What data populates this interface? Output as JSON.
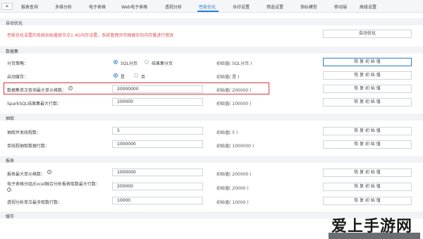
{
  "tabs": [
    "报表查询",
    "多维分析",
    "电子表格",
    "Web电子表格",
    "透视分析",
    "性能优化",
    "水印设置",
    "筛选设置",
    "指标模型",
    "移动端",
    "高级设置"
  ],
  "active_tab": "性能优化",
  "sections": {
    "auto_opt": "自动优化",
    "dataset": "数据集",
    "extract": "抽取",
    "report": "报表",
    "cache": "缓存"
  },
  "auto_opt": {
    "warning": "性能优化设置的系统初始值按节点1.4G内存设置，系统管理员可根据实际内存量进行修改",
    "button": "自动优化"
  },
  "rows": [
    {
      "label": "分页策略：",
      "initial": "初始值( SQL分页 )",
      "button": "恢 复 初 始 值"
    },
    {
      "label": "启动缓存：",
      "initial": "初始值( 是 )",
      "button": "恢 复 初 始 值"
    },
    {
      "label": "数据集单次查询最大单元格数：",
      "value": "20000000",
      "initial": "初始值( 200000 )",
      "button": "恢 复 初 始 值"
    },
    {
      "label": "SparkSQL结果集最大行数：",
      "value": "100000",
      "initial": "初始值( 100000 )",
      "button": "恢 复 初 始 值"
    },
    {
      "label": "抽取并发线程数：",
      "value": "5",
      "initial": "初始值( 5 )",
      "button": "恢 复 初 始 值"
    },
    {
      "label": "单线程抽取数据行数：",
      "value": "1000000",
      "initial": "初始值( 1000000 )",
      "button": "恢 复 初 始 值"
    },
    {
      "label": "报表最大单元格数：",
      "value": "1000000",
      "initial": "初始值( 200000 )",
      "button": "恢 复 初 始 值"
    },
    {
      "label": "电子表格分组/Excel融合分析报表取数最大行数：",
      "value": "200000",
      "initial": "初始值( 20000 )",
      "button": "恢 复 初 始 值"
    },
    {
      "label": "透视分析单次最多取数行数：",
      "value": "10000",
      "initial": "初始值( 10000 )",
      "button": "恢 复 初 始 值"
    }
  ],
  "paging_options": [
    "SQL分页",
    "结果集分页"
  ],
  "cache_options": [
    "是",
    "否"
  ],
  "watermark": "爱上手游网",
  "colors": {
    "accent": "#2a7fd0",
    "highlight_box": "#d9383a",
    "warning": "#d9534f"
  }
}
